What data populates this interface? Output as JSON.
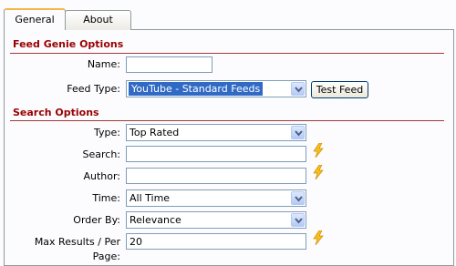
{
  "tabs": [
    {
      "label": "General"
    },
    {
      "label": "About"
    }
  ],
  "sections": {
    "feed": {
      "title": "Feed Genie Options"
    },
    "search": {
      "title": "Search Options"
    }
  },
  "fields": {
    "name": {
      "label": "Name:",
      "value": ""
    },
    "feed_type": {
      "label": "Feed Type:",
      "value": "YouTube - Standard Feeds"
    },
    "test_feed": {
      "label": "Test Feed"
    },
    "type": {
      "label": "Type:",
      "value": "Top Rated"
    },
    "search": {
      "label": "Search:",
      "value": ""
    },
    "author": {
      "label": "Author:",
      "value": ""
    },
    "time": {
      "label": "Time:",
      "value": "All Time"
    },
    "order_by": {
      "label": "Order By:",
      "value": "Relevance"
    },
    "max_results": {
      "label": "Max Results / Per Page:",
      "value": "20"
    }
  },
  "icons": {
    "lightning": "lightning-icon",
    "dropdown": "chevron-down-icon"
  },
  "colors": {
    "section_title": "#990000",
    "rule": "#a23a3a",
    "selected_bg": "#316ac5",
    "bolt_fill": "#f6c01d"
  }
}
